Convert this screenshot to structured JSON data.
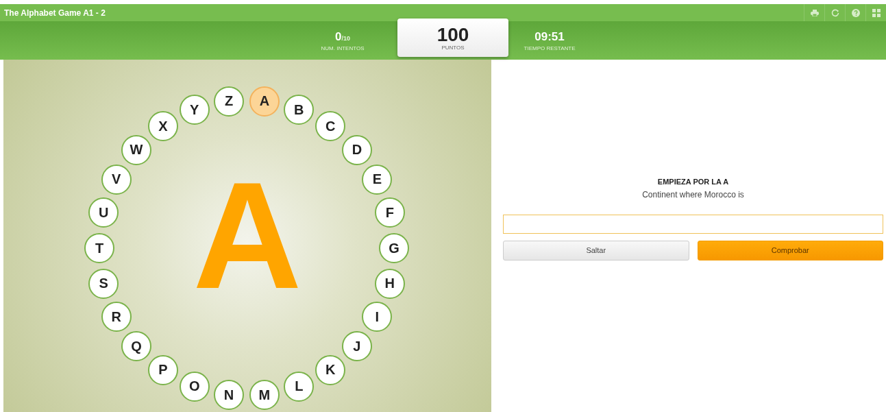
{
  "window": {
    "title": "The Alphabet Game A1 - 2"
  },
  "toolbar": [
    {
      "kind": "print"
    },
    {
      "kind": "restart"
    },
    {
      "kind": "help"
    },
    {
      "kind": "grid"
    }
  ],
  "stats": {
    "attempts": {
      "value": "0",
      "max": "/10",
      "label": "NUM. INTENTOS"
    },
    "score": {
      "value": "100",
      "label": "PUNTOS"
    },
    "time": {
      "value": "09:51",
      "label": "TIEMPO RESTANTE"
    }
  },
  "current_letter": "A",
  "letters": [
    {
      "label": "A",
      "selected": true
    },
    {
      "label": "B",
      "selected": false
    },
    {
      "label": "C",
      "selected": false
    },
    {
      "label": "D",
      "selected": false
    },
    {
      "label": "E",
      "selected": false
    },
    {
      "label": "F",
      "selected": false
    },
    {
      "label": "G",
      "selected": false
    },
    {
      "label": "H",
      "selected": false
    },
    {
      "label": "I",
      "selected": false
    },
    {
      "label": "J",
      "selected": false
    },
    {
      "label": "K",
      "selected": false
    },
    {
      "label": "L",
      "selected": false
    },
    {
      "label": "M",
      "selected": false
    },
    {
      "label": "N",
      "selected": false
    },
    {
      "label": "O",
      "selected": false
    },
    {
      "label": "P",
      "selected": false
    },
    {
      "label": "Q",
      "selected": false
    },
    {
      "label": "R",
      "selected": false
    },
    {
      "label": "S",
      "selected": false
    },
    {
      "label": "T",
      "selected": false
    },
    {
      "label": "U",
      "selected": false
    },
    {
      "label": "V",
      "selected": false
    },
    {
      "label": "W",
      "selected": false
    },
    {
      "label": "X",
      "selected": false
    },
    {
      "label": "Y",
      "selected": false
    },
    {
      "label": "Z",
      "selected": false
    }
  ],
  "question": {
    "heading": "EMPIEZA POR LA A",
    "clue": "Continent where Morocco is"
  },
  "buttons": [
    {
      "kind": "skip",
      "label": "Saltar"
    },
    {
      "kind": "check",
      "label": "Comprobar"
    }
  ]
}
